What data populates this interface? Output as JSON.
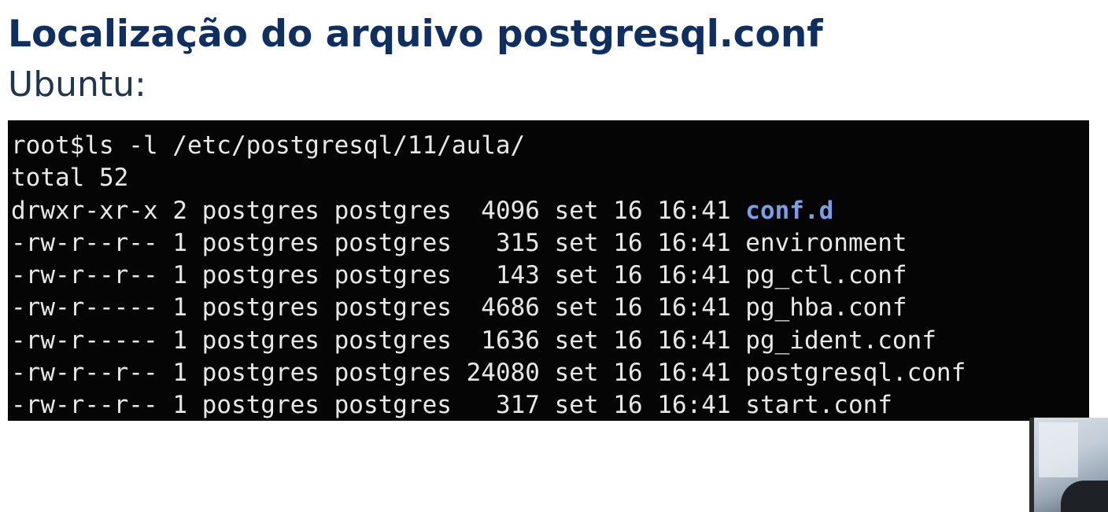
{
  "slide": {
    "title": "Localização do arquivo postgresql.conf",
    "subtitle": "Ubuntu:"
  },
  "terminal": {
    "command": "root$ls -l /etc/postgresql/11/aula/",
    "total": "total 52",
    "entries": [
      {
        "perms": "drwxr-xr-x",
        "links": "2",
        "owner": "postgres",
        "group": "postgres",
        "size": "4096",
        "month": "set",
        "day": "16",
        "time": "16:41",
        "name": "conf.d",
        "is_dir": true
      },
      {
        "perms": "-rw-r--r--",
        "links": "1",
        "owner": "postgres",
        "group": "postgres",
        "size": "315",
        "month": "set",
        "day": "16",
        "time": "16:41",
        "name": "environment",
        "is_dir": false
      },
      {
        "perms": "-rw-r--r--",
        "links": "1",
        "owner": "postgres",
        "group": "postgres",
        "size": "143",
        "month": "set",
        "day": "16",
        "time": "16:41",
        "name": "pg_ctl.conf",
        "is_dir": false
      },
      {
        "perms": "-rw-r-----",
        "links": "1",
        "owner": "postgres",
        "group": "postgres",
        "size": "4686",
        "month": "set",
        "day": "16",
        "time": "16:41",
        "name": "pg_hba.conf",
        "is_dir": false
      },
      {
        "perms": "-rw-r-----",
        "links": "1",
        "owner": "postgres",
        "group": "postgres",
        "size": "1636",
        "month": "set",
        "day": "16",
        "time": "16:41",
        "name": "pg_ident.conf",
        "is_dir": false
      },
      {
        "perms": "-rw-r--r--",
        "links": "1",
        "owner": "postgres",
        "group": "postgres",
        "size": "24080",
        "month": "set",
        "day": "16",
        "time": "16:41",
        "name": "postgresql.conf",
        "is_dir": false
      },
      {
        "perms": "-rw-r--r--",
        "links": "1",
        "owner": "postgres",
        "group": "postgres",
        "size": "317",
        "month": "set",
        "day": "16",
        "time": "16:41",
        "name": "start.conf",
        "is_dir": false
      }
    ]
  },
  "colors": {
    "title": "#0f2f62",
    "subtitle": "#1f3551",
    "terminal_bg": "#050505",
    "terminal_text": "#e8e8e8",
    "directory": "#7a9fe6"
  }
}
